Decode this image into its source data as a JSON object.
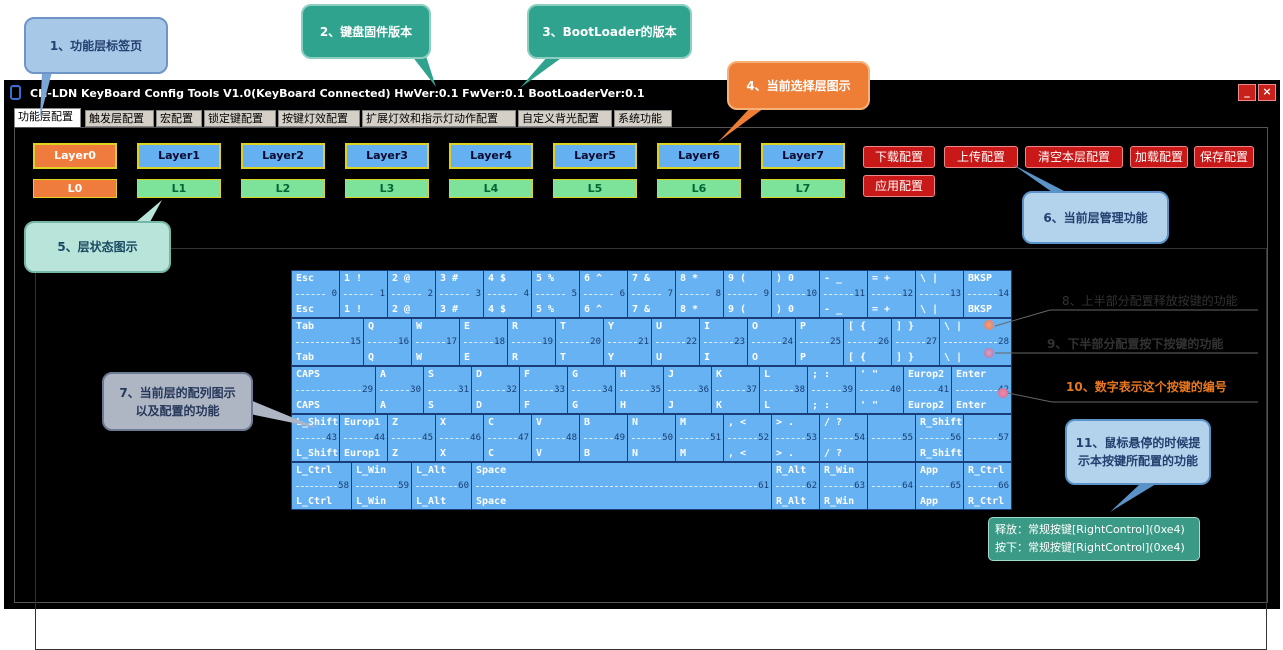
{
  "window": {
    "title": "CH-LDN KeyBoard Config Tools V1.0(KeyBoard Connected)  HwVer:0.1  FwVer:0.1  BootLoaderVer:0.1",
    "minimize": "_",
    "close": "×"
  },
  "tabs": [
    "功能层配置",
    "触发层配置",
    "宏配置",
    "锁定键配置",
    "按键灯效配置",
    "扩展灯效和指示灯动作配置",
    "自定义背光配置",
    "系统功能"
  ],
  "layers": [
    "Layer0",
    "Layer1",
    "Layer2",
    "Layer3",
    "Layer4",
    "Layer5",
    "Layer6",
    "Layer7"
  ],
  "layer_status": [
    "L0",
    "L1",
    "L2",
    "L3",
    "L4",
    "L5",
    "L6",
    "L7"
  ],
  "selected_layer_index": 0,
  "actions": [
    "下载配置",
    "上传配置",
    "清空本层配置",
    "加载配置",
    "保存配置",
    "应用配置"
  ],
  "colors": {
    "selected": "#ef7c3d",
    "layer": "#64b0f0",
    "status": "#7ee39a",
    "key": "#66b2f2",
    "action": "#c81818"
  },
  "keyboard": {
    "rows": [
      [
        {
          "top": "Esc",
          "bottom": "Esc",
          "num": "0"
        },
        {
          "top": "1 !",
          "bottom": "1 !",
          "num": "1"
        },
        {
          "top": "2 @",
          "bottom": "2 @",
          "num": "2"
        },
        {
          "top": "3 #",
          "bottom": "3 #",
          "num": "3"
        },
        {
          "top": "4 $",
          "bottom": "4 $",
          "num": "4"
        },
        {
          "top": "5 %",
          "bottom": "5 %",
          "num": "5"
        },
        {
          "top": "6 ^",
          "bottom": "6 ^",
          "num": "6"
        },
        {
          "top": "7 &",
          "bottom": "7 &",
          "num": "7"
        },
        {
          "top": "8 *",
          "bottom": "8 *",
          "num": "8"
        },
        {
          "top": "9 (",
          "bottom": "9 (",
          "num": "9"
        },
        {
          "top": ") 0",
          "bottom": ") 0",
          "num": "10"
        },
        {
          "top": "- _",
          "bottom": "- _",
          "num": "11"
        },
        {
          "top": "= +",
          "bottom": "= +",
          "num": "12"
        },
        {
          "top": "\\ |",
          "bottom": "\\ |",
          "num": "13"
        },
        {
          "top": "BKSP",
          "bottom": "BKSP",
          "num": "14"
        }
      ],
      [
        {
          "top": "Tab",
          "bottom": "Tab",
          "num": "15"
        },
        {
          "top": "Q",
          "bottom": "Q",
          "num": "16"
        },
        {
          "top": "W",
          "bottom": "W",
          "num": "17"
        },
        {
          "top": "E",
          "bottom": "E",
          "num": "18"
        },
        {
          "top": "R",
          "bottom": "R",
          "num": "19"
        },
        {
          "top": "T",
          "bottom": "T",
          "num": "20"
        },
        {
          "top": "Y",
          "bottom": "Y",
          "num": "21"
        },
        {
          "top": "U",
          "bottom": "U",
          "num": "22"
        },
        {
          "top": "I",
          "bottom": "I",
          "num": "23"
        },
        {
          "top": "O",
          "bottom": "O",
          "num": "24"
        },
        {
          "top": "P",
          "bottom": "P",
          "num": "25"
        },
        {
          "top": "[ {",
          "bottom": "[ {",
          "num": "26"
        },
        {
          "top": "] }",
          "bottom": "] }",
          "num": "27"
        },
        {
          "top": "\\ |",
          "bottom": "\\ |",
          "num": "28"
        }
      ],
      [
        {
          "top": "CAPS",
          "bottom": "CAPS",
          "num": "29"
        },
        {
          "top": "A",
          "bottom": "A",
          "num": "30"
        },
        {
          "top": "S",
          "bottom": "S",
          "num": "31"
        },
        {
          "top": "D",
          "bottom": "D",
          "num": "32"
        },
        {
          "top": "F",
          "bottom": "F",
          "num": "33"
        },
        {
          "top": "G",
          "bottom": "G",
          "num": "34"
        },
        {
          "top": "H",
          "bottom": "H",
          "num": "35"
        },
        {
          "top": "J",
          "bottom": "J",
          "num": "36"
        },
        {
          "top": "K",
          "bottom": "K",
          "num": "37"
        },
        {
          "top": "L",
          "bottom": "L",
          "num": "38"
        },
        {
          "top": "; :",
          "bottom": "; :",
          "num": "39"
        },
        {
          "top": "' \"",
          "bottom": "' \"",
          "num": "40"
        },
        {
          "top": "Europ2",
          "bottom": "Europ2",
          "num": "41"
        },
        {
          "top": "Enter",
          "bottom": "Enter",
          "num": "42"
        }
      ],
      [
        {
          "top": "L_Shift",
          "bottom": "L_Shift",
          "num": "43"
        },
        {
          "top": "Europ1",
          "bottom": "Europ1",
          "num": "44"
        },
        {
          "top": "Z",
          "bottom": "Z",
          "num": "45"
        },
        {
          "top": "X",
          "bottom": "X",
          "num": "46"
        },
        {
          "top": "C",
          "bottom": "C",
          "num": "47"
        },
        {
          "top": "V",
          "bottom": "V",
          "num": "48"
        },
        {
          "top": "B",
          "bottom": "B",
          "num": "49"
        },
        {
          "top": "N",
          "bottom": "N",
          "num": "50"
        },
        {
          "top": "M",
          "bottom": "M",
          "num": "51"
        },
        {
          "top": ", <",
          "bottom": ", <",
          "num": "52"
        },
        {
          "top": "> .",
          "bottom": "> .",
          "num": "53"
        },
        {
          "top": "/ ?",
          "bottom": "/ ?",
          "num": "54"
        },
        {
          "top": "",
          "bottom": "",
          "num": "55"
        },
        {
          "top": "R_Shift",
          "bottom": "R_Shift",
          "num": "56"
        },
        {
          "top": "",
          "bottom": "",
          "num": "57"
        }
      ],
      [
        {
          "top": "L_Ctrl",
          "bottom": "L_Ctrl",
          "num": "58"
        },
        {
          "top": "L_Win",
          "bottom": "L_Win",
          "num": "59"
        },
        {
          "top": "L_Alt",
          "bottom": "L_Alt",
          "num": "60"
        },
        {
          "top": "Space",
          "bottom": "Space",
          "num": "61"
        },
        {
          "top": "R_Alt",
          "bottom": "R_Alt",
          "num": "62"
        },
        {
          "top": "R_Win",
          "bottom": "R_Win",
          "num": "63"
        },
        {
          "top": "",
          "bottom": "",
          "num": "64"
        },
        {
          "top": "App",
          "bottom": "App",
          "num": "65"
        },
        {
          "top": "R_Ctrl",
          "bottom": "R_Ctrl",
          "num": "66"
        }
      ]
    ]
  },
  "tooltip": {
    "release": "释放：常规按键[RightControl](0xe4)",
    "press": "按下：常规按键[RightControl](0xe4)"
  },
  "annotations": {
    "c1": "1、功能层标签页",
    "c2": "2、键盘固件版本",
    "c3": "3、BootLoader的版本",
    "c4": "4、当前选择层图示",
    "c5": "5、层状态图示",
    "c6": "6、当前层管理功能",
    "c7": "7、当前层的配列图示以及配置的功能",
    "c8": "8、上半部分配置释放按键的功能",
    "c9": "9、下半部分配置按下按键的功能",
    "c10": "10、数字表示这个按键的编号",
    "c11": "11、鼠标悬停的时候提示本按键所配置的功能"
  }
}
